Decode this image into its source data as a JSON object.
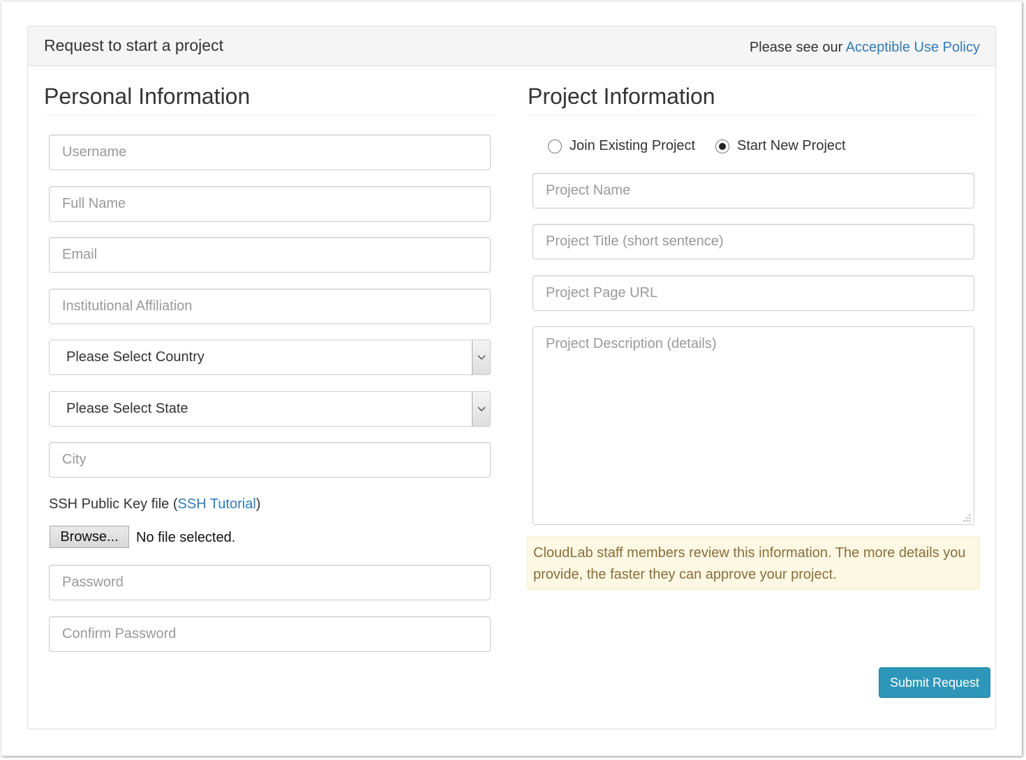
{
  "header": {
    "title": "Request to start a project",
    "policy_prefix": "Please see our ",
    "policy_link": "Acceptible Use Policy"
  },
  "personal": {
    "heading": "Personal Information",
    "username_placeholder": "Username",
    "fullname_placeholder": "Full Name",
    "email_placeholder": "Email",
    "affiliation_placeholder": "Institutional Affiliation",
    "country_selected": "Please Select Country",
    "state_selected": "Please Select State",
    "city_placeholder": "City",
    "ssh_label_prefix": "SSH Public Key file (",
    "ssh_tutorial_link": "SSH Tutorial",
    "ssh_label_suffix": ")",
    "browse_label": "Browse...",
    "no_file_text": "No file selected.",
    "password_placeholder": "Password",
    "confirm_password_placeholder": "Confirm Password"
  },
  "project": {
    "heading": "Project Information",
    "radio_join_label": "Join Existing Project",
    "radio_new_label": "Start New Project",
    "selected_option": "Start New Project",
    "name_placeholder": "Project Name",
    "title_placeholder": "Project Title (short sentence)",
    "url_placeholder": "Project Page URL",
    "description_placeholder": "Project Description (details)",
    "notice": "CloudLab staff members review this information. The more details you provide, the faster they can approve your project."
  },
  "actions": {
    "submit_label": "Submit Request"
  },
  "colors": {
    "link": "#337ab7",
    "submit": "#2e96b8",
    "notice_bg": "#fcf8e3",
    "notice_text": "#8a6d3b"
  }
}
